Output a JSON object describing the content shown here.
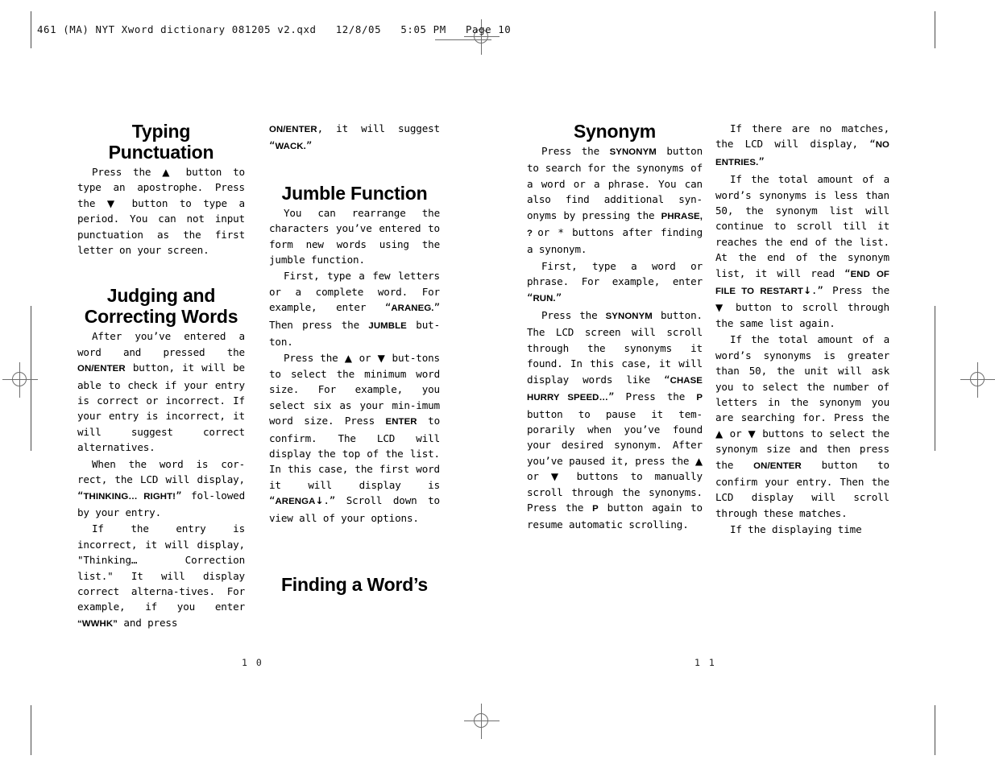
{
  "header": {
    "slug": "461 (MA) NYT Xword dictionary 081205 v2.qxd   12/8/05   5:05 PM   Page 10"
  },
  "folios": {
    "left": "1 0",
    "right": "1 1"
  },
  "columns": {
    "one": {
      "heading_1": "Typing Punctuation",
      "para_1_a": "Press the ",
      "para_1_arrow_up": "▲",
      "para_1_b": " button to type an apostrophe. Press the ",
      "para_1_arrow_dn": "▼",
      "para_1_c": " button to type a period. You can not input punctuation as the first letter on your screen.",
      "heading_2": "Judging and Correcting Words",
      "para_2_a": "After you’ve entered a word and pressed the ",
      "para_2_kb": "ON/ENTER",
      "para_2_b": " button, it will be able to check if your entry is correct or incorrect. If your entry is incorrect, it will suggest correct alternatives.",
      "para_3_a": "When the word is cor-rect, the LCD will display, “",
      "para_3_kb": "THINKING…     RIGHT!",
      "para_3_b": "” fol-lowed by your entry.",
      "para_4_a": "If the entry is incorrect, it will display, \"Thinking… Correction list.\" It will display correct alterna-tives. For example, if you enter ",
      "para_4_kb": "“WWHK”",
      "para_4_b": " and press"
    },
    "two": {
      "cont_kb": "ON/ENTER",
      "cont_a": ", it will suggest “",
      "cont_kb2": "WACK.",
      "cont_b": "”",
      "heading_1": "Jumble Function",
      "para_1": "You can rearrange the characters you’ve entered to form new words using the jumble function.",
      "para_2_a": "First, type a few letters or a complete word. For example, enter “",
      "para_2_kb": "ARANEG.",
      "para_2_b": "” Then press the ",
      "para_2_kb2": "JUMBLE",
      "para_2_c": " but-ton.",
      "para_3_a": "Press the ",
      "para_3_arrow_up": "▲",
      "para_3_b": " or ",
      "para_3_arrow_dn": "▼",
      "para_3_c": " but-tons to select the minimum word size. For example, you select six as your min-imum word size. Press ",
      "para_3_kb": "ENTER",
      "para_3_d": " to confirm. The LCD will display the top of the list. In this case, the first word it will display is “",
      "para_3_kb2": "ARENGA",
      "para_3_dnglyph": "↓",
      "para_3_e": ".” Scroll down to view all of your options.",
      "heading_2": "Finding a Word’s"
    },
    "three": {
      "heading_1": "Synonym",
      "para_1_a": "Press the ",
      "para_1_kb": "SYNONYM",
      "para_1_b": " button to search for the synonyms of a word or a phrase. You can also find additional syn-onyms by pressing the ",
      "para_1_kb2": "PHRASE,",
      "para_1_q": " ? ",
      "para_1_c": "or * buttons after finding a synonym.",
      "para_2_a": "First, type a word or phrase. For example, enter “",
      "para_2_kb": "RUN.",
      "para_2_b": "”",
      "para_3_a": "Press the ",
      "para_3_kb": "SYNONYM",
      "para_3_b": " button. The LCD screen will scroll through the synonyms it found. In this case, it will display words like “",
      "para_3_kb2": "CHASE HURRY SPEED…",
      "para_3_c": "” Press the ",
      "para_3_kb3": "P",
      "para_3_d": " button to pause it tem-porarily when you’ve found your desired synonym. After you’ve paused it, press the ",
      "para_3_arrow_up": "▲",
      "para_3_e": " or ",
      "para_3_arrow_dn": "▼",
      "para_3_f": " buttons to manually scroll through the synonyms. Press the ",
      "para_3_kb4": "P",
      "para_3_g": " button again to resume automatic scrolling."
    },
    "four": {
      "para_1_a": "If there are no matches, the LCD will display, “",
      "para_1_kb": "NO ENTRIES.",
      "para_1_b": "”",
      "para_2_a": "If the total amount of a word’s synonyms is less than 50, the synonym list will continue to scroll till it reaches the end of the list. At the end of the synonym list, it will read “",
      "para_2_kb": "END OF FILE TO RESTART",
      "para_2_dnglyph": "↓",
      "para_2_b": ".” Press the ",
      "para_2_arrow_dn": "▼",
      "para_2_c": " button to scroll through the same list again.",
      "para_3_a": "If the total amount of a word’s synonyms is greater than 50, the unit will ask you to select the number of letters in the synonym you are searching for. Press the ",
      "para_3_arrow_up": "▲",
      "para_3_b": " or ",
      "para_3_arrow_dn": "▼",
      "para_3_c": " buttons to select the synonym size and then press the ",
      "para_3_kb": "ON/ENTER",
      "para_3_d": " button to confirm your entry. Then the LCD display will scroll through these matches.",
      "para_4": "If the displaying time"
    }
  }
}
